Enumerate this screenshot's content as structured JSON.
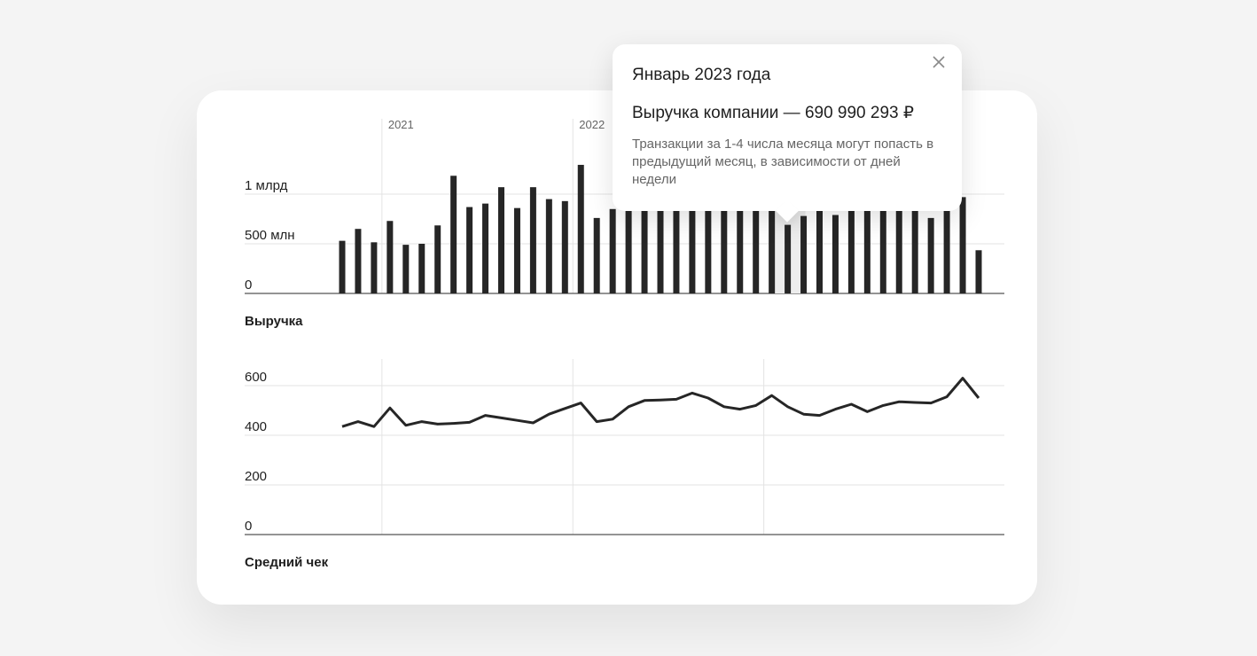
{
  "tooltip": {
    "month": "Январь 2023 года",
    "revenue": "Выручка компании — 690 990 293 ₽",
    "note": "Транзакции за 1-4 числа месяца могут попасть в предыдущий месяц, в зависимости от дней недели",
    "close_icon": "close-icon"
  },
  "highlight_index": 28,
  "chart_data": [
    {
      "type": "bar",
      "title": "Выручка",
      "year_labels": [
        {
          "label": "2021",
          "index": 3
        },
        {
          "label": "2022",
          "index": 15
        }
      ],
      "y_ticks": [
        {
          "value": 0,
          "label": "0"
        },
        {
          "value": 500000000,
          "label": "500 млн"
        },
        {
          "value": 1000000000,
          "label": "1 млрд"
        }
      ],
      "ylim": [
        0,
        1300000000
      ],
      "values": [
        530000000,
        650000000,
        515000000,
        730000000,
        490000000,
        500000000,
        685000000,
        1185000000,
        870000000,
        905000000,
        1070000000,
        860000000,
        1070000000,
        950000000,
        930000000,
        1295000000,
        760000000,
        850000000,
        900000000,
        920000000,
        950000000,
        960000000,
        980000000,
        990000000,
        1000000000,
        960000000,
        940000000,
        920000000,
        690990293,
        780000000,
        850000000,
        790000000,
        880000000,
        900000000,
        910000000,
        920000000,
        940000000,
        760000000,
        940000000,
        970000000,
        435000000
      ],
      "bar_color": "#262626",
      "grid": true
    },
    {
      "type": "line",
      "title": "Средний чек",
      "y_ticks": [
        {
          "value": 0,
          "label": "0"
        },
        {
          "value": 200,
          "label": "200"
        },
        {
          "value": 400,
          "label": "400"
        },
        {
          "value": 600,
          "label": "600"
        }
      ],
      "ylim": [
        0,
        600
      ],
      "year_boundaries": [
        3,
        15,
        27
      ],
      "values": [
        435,
        455,
        435,
        510,
        440,
        455,
        445,
        448,
        452,
        480,
        470,
        460,
        450,
        485,
        508,
        530,
        455,
        465,
        515,
        540,
        542,
        545,
        570,
        550,
        515,
        505,
        520,
        560,
        515,
        485,
        480,
        505,
        525,
        495,
        520,
        535,
        532,
        530,
        555,
        630,
        550
      ],
      "line_color": "#262626",
      "grid": true
    }
  ]
}
